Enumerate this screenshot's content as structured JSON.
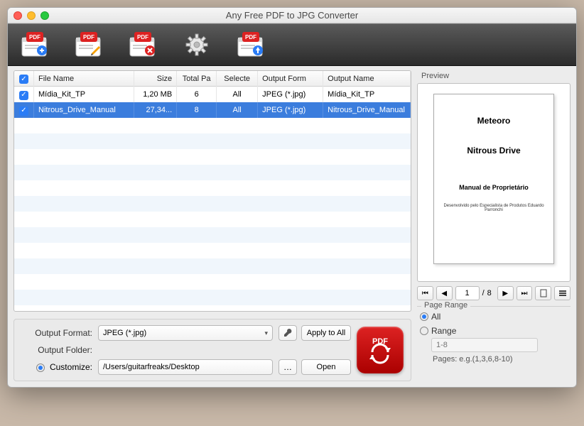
{
  "window": {
    "title": "Any Free PDF to JPG Converter"
  },
  "toolbar": {
    "buttons": [
      "add-pdf",
      "edit-pdf",
      "remove-pdf",
      "settings",
      "export-pdf"
    ]
  },
  "table": {
    "headers": {
      "filename": "File Name",
      "size": "Size",
      "total_pages": "Total Pa",
      "selected": "Selecte",
      "output_format": "Output Form",
      "output_name": "Output Name"
    },
    "rows": [
      {
        "checked": true,
        "selected": false,
        "filename": "Mídia_Kit_TP",
        "size": "1,20 MB",
        "total_pages": "6",
        "selected_pages": "All",
        "format": "JPEG (*.jpg)",
        "output_name": "Mídia_Kit_TP"
      },
      {
        "checked": true,
        "selected": true,
        "filename": "Nitrous_Drive_Manual",
        "size": "27,34...",
        "total_pages": "8",
        "selected_pages": "All",
        "format": "JPEG (*.jpg)",
        "output_name": "Nitrous_Drive_Manual"
      }
    ]
  },
  "output": {
    "format_label": "Output Format:",
    "format_value": "JPEG (*.jpg)",
    "apply_all": "Apply to All",
    "folder_label": "Output Folder:",
    "customize_label": "Customize:",
    "customize_path": "/Users/guitarfreaks/Desktop",
    "open": "Open",
    "convert_label": "PDF"
  },
  "preview": {
    "title": "Preview",
    "page": {
      "line1": "Meteoro",
      "line2": "Nitrous Drive",
      "line3": "Manual de Proprietário",
      "line4": "Desenvolvido pelo Especialista de Produtos Eduardo Parronchi"
    },
    "nav": {
      "current": "1",
      "sep": "/",
      "total": "8"
    },
    "range": {
      "title": "Page Range",
      "all": "All",
      "range": "Range",
      "placeholder": "1-8",
      "hint": "Pages: e.g.(1,3,6,8-10)",
      "selected": "all"
    }
  },
  "colors": {
    "accent": "#2a7cf6",
    "row_selected": "#3b7ddd",
    "pdf_red": "#c11"
  }
}
